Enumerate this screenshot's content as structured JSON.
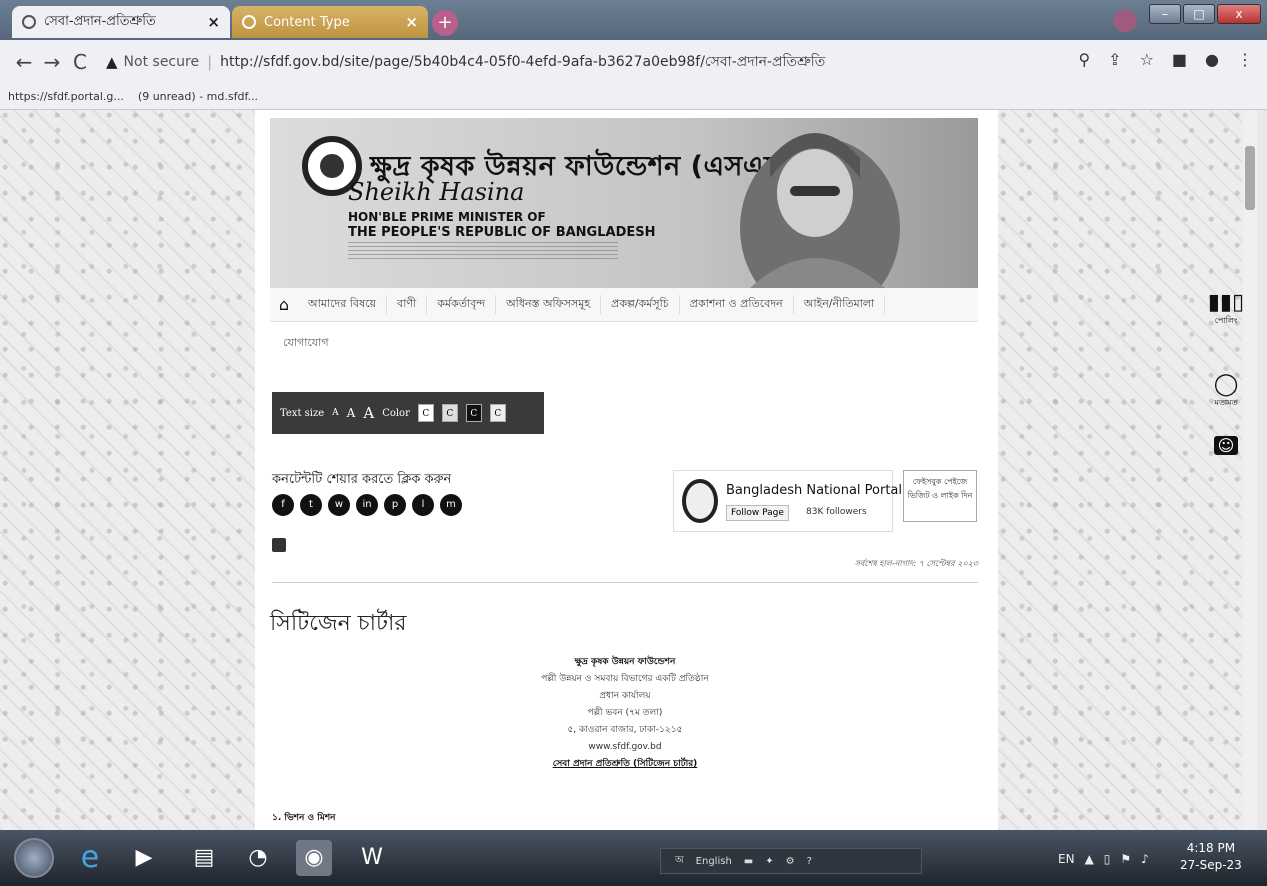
{
  "browser": {
    "tabs": [
      {
        "title": "সেবা-প্রদান-প্রতিশ্রুতি",
        "close": "×"
      },
      {
        "title": "Content Type",
        "close": "×"
      }
    ],
    "new_tab": "+",
    "window_controls": {
      "minimize": "–",
      "maximize": "□",
      "close": "x"
    },
    "nav": {
      "back": "←",
      "forward": "→",
      "reload": "C"
    },
    "security_icon": "warning-triangle-icon",
    "not_secure": "Not secure",
    "url": "http://sfdf.gov.bd/site/page/5b40b4c4-05f0-4efd-9afa-b3627a0eb98f/সেবা-প্রদান-প্রতিশ্রুতি",
    "bookmarks": [
      "https://sfdf.portal.g...",
      "(9 unread) - md.sfdf..."
    ],
    "toolbar_icons": [
      "zoom-icon",
      "share-icon",
      "star-icon",
      "sidepanel-icon",
      "profile-icon",
      "menu-icon"
    ]
  },
  "site": {
    "org_title": "ক্ষুদ্র কৃষক উন্নয়ন ফাউন্ডেশন (এসএফডিএফ)",
    "signature": "Sheikh Hasina",
    "pm_line1": "HON'BLE PRIME MINISTER OF",
    "pm_line2": "THE PEOPLE'S REPUBLIC OF BANGLADESH",
    "menu": [
      "আমাদের বিষয়ে",
      "বাণী",
      "কর্মকর্তাবৃন্দ",
      "অধিনস্ত অফিসসমূহ",
      "প্রকল্প/কর্মসূচি",
      "প্রকাশনা ও প্রতিবেদন",
      "আইন/নীতিমালা"
    ],
    "menu_second_row": "যোগাযোগ",
    "access": {
      "text_size": "Text size",
      "a_small": "A",
      "a_mid": "A",
      "a_large": "A",
      "color": "Color",
      "swatches": [
        "C",
        "C",
        "C",
        "C"
      ]
    },
    "share_title": "কনটেন্টটি শেয়ার করতে ক্লিক করুন",
    "share_icons": [
      "f",
      "t",
      "w",
      "in",
      "p",
      "l",
      "m"
    ],
    "fb": {
      "name": "Bangladesh National Portal",
      "follow": "Follow Page",
      "followers": "83K followers"
    },
    "fb_side": "ফেইসবুক পেইজে ভিজিট ও লাইক দিন",
    "last_update": "সর্বশেষ হাল-নাগাদ: ৭ সেপ্টেম্বর ২০২৩",
    "heading": "সিটিজেন চার্টার",
    "center_lines": [
      "ক্ষুদ্র কৃষক উন্নয়ন ফাউন্ডেশন",
      "পল্লী উন্নয়ন ও সমবায় বিভাগের একটি প্রতিষ্ঠান",
      "প্রধান কার্যালয়",
      "পল্লী ভবন (৭ম তলা)",
      "৫, কাওরান বাজার, ঢাকা-১২১৫",
      "www.sfdf.gov.bd",
      "সেবা প্রদান প্রতিশ্রুতি (সিটিজেন চার্টার)"
    ],
    "section_1": "১. ভিশন ও মিশন",
    "side_widgets": [
      {
        "icon": "bar-chart-icon",
        "label": "পোলিং"
      },
      {
        "icon": "comment-icon",
        "label": "মতামত"
      },
      {
        "icon": "accessibility-icon",
        "label": ""
      }
    ]
  },
  "taskbar": {
    "lang_bar": "English",
    "tray_lang": "EN",
    "time": "4:18 PM",
    "date": "27-Sep-23"
  }
}
